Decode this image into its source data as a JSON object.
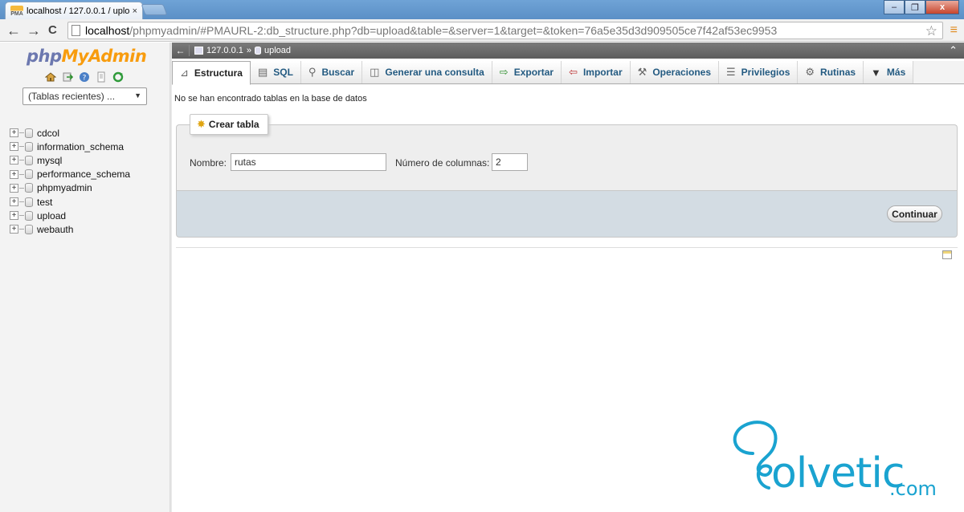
{
  "browser": {
    "tab_title": "localhost / 127.0.0.1 / uplo",
    "tab_close": "×",
    "favicon_text": "PMA",
    "url_host": "localhost",
    "url_path": "/phpmyadmin/#PMAURL-2:db_structure.php?db=upload&table=&server=1&target=&token=76a5e35d3d909505ce7f42af53ec9953",
    "back": "←",
    "forward": "→",
    "reload": "C",
    "star": "☆",
    "menu": "≡",
    "win_minimize": "–",
    "win_maximize": "❐",
    "win_close": "x"
  },
  "sidebar": {
    "logo_php": "php",
    "logo_myadmin": "MyAdmin",
    "recent_select": "(Tablas recientes) ...",
    "databases": [
      {
        "name": "cdcol"
      },
      {
        "name": "information_schema"
      },
      {
        "name": "mysql"
      },
      {
        "name": "performance_schema"
      },
      {
        "name": "phpmyadmin"
      },
      {
        "name": "test"
      },
      {
        "name": "upload"
      },
      {
        "name": "webauth"
      }
    ],
    "expander_symbol": "+"
  },
  "breadcrumb": {
    "server": "127.0.0.1",
    "sep": "»",
    "database": "upload",
    "collapse": "←",
    "up": "⌃"
  },
  "tabs": [
    {
      "label": "Estructura",
      "icon": "structure-icon",
      "active": true
    },
    {
      "label": "SQL",
      "icon": "sql-icon"
    },
    {
      "label": "Buscar",
      "icon": "search-icon"
    },
    {
      "label": "Generar una consulta",
      "icon": "query-icon"
    },
    {
      "label": "Exportar",
      "icon": "export-icon"
    },
    {
      "label": "Importar",
      "icon": "import-icon"
    },
    {
      "label": "Operaciones",
      "icon": "wrench-icon"
    },
    {
      "label": "Privilegios",
      "icon": "privileges-icon"
    },
    {
      "label": "Rutinas",
      "icon": "routines-icon"
    },
    {
      "label": "Más",
      "icon": "more-icon"
    }
  ],
  "main": {
    "notice": "No se han encontrado tablas en la base de datos",
    "create_table": {
      "legend": "Crear tabla",
      "name_label": "Nombre:",
      "name_value": "rutas",
      "columns_label": "Número de columnas:",
      "columns_value": "2",
      "submit": "Continuar"
    }
  },
  "watermark": {
    "brand": "olvetic",
    "domain": ".com"
  },
  "colors": {
    "accent": "#235a81",
    "logo_orange": "#f89c0e",
    "logo_blue": "#6c78af",
    "watermark": "#1aa3d0"
  }
}
